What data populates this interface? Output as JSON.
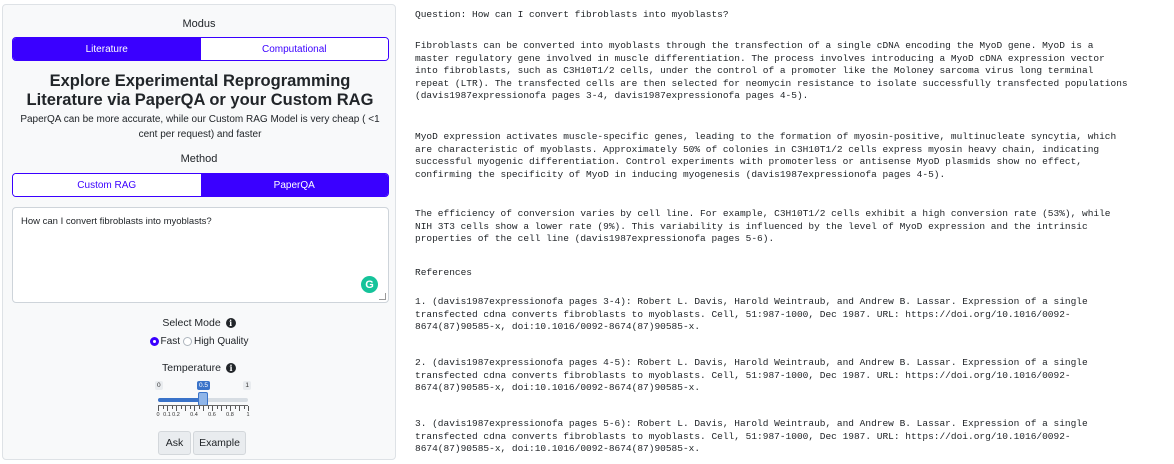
{
  "modus": {
    "label": "Modus",
    "options": [
      "Literature",
      "Computational"
    ],
    "selected": "Literature"
  },
  "hero": {
    "title": "Explore Experimental Reprogramming Literature via PaperQA or your Custom RAG",
    "description": "PaperQA can be more accurate, while our Custom RAG Model is very cheap ( <1 cent per request) and faster"
  },
  "method": {
    "label": "Method",
    "options": [
      "Custom RAG",
      "PaperQA"
    ],
    "selected": "PaperQA"
  },
  "question_input": {
    "value": "How can I convert fibroblasts into myoblasts?"
  },
  "icons": {
    "grammarly": "grammarly-icon",
    "info": "info-icon",
    "grammarly_glyph": "G",
    "info_glyph": "i"
  },
  "select_mode": {
    "label": "Select Mode",
    "options": [
      "Fast",
      "High Quality"
    ],
    "selected": "Fast"
  },
  "temperature": {
    "label": "Temperature",
    "min": "0",
    "max": "1",
    "value": 0.5,
    "value_label": "0.5",
    "tick_labels": [
      "0",
      "0.1",
      "0.2",
      "0.4",
      "0.6",
      "0.8",
      "1"
    ]
  },
  "buttons": {
    "ask": "Ask",
    "example": "Example"
  },
  "answer": {
    "question": "Question: How can I convert fibroblasts into myoblasts?",
    "paragraphs": [
      "Fibroblasts can be converted into myoblasts through the transfection of a single cDNA encoding the MyoD gene. MyoD is a\nmaster regulatory gene involved in muscle differentiation. The process involves introducing a MyoD cDNA expression vector\ninto fibroblasts, such as C3H10T1/2 cells, under the control of a promoter like the Moloney sarcoma virus long terminal\nrepeat (LTR). The transfected cells are then selected for neomycin resistance to isolate successfully transfected populations\n(davis1987expressionofa pages 3-4, davis1987expressionofa pages 4-5).",
      "MyoD expression activates muscle-specific genes, leading to the formation of myosin-positive, multinucleate syncytia, which\nare characteristic of myoblasts. Approximately 50% of colonies in C3H10T1/2 cells express myosin heavy chain, indicating\nsuccessful myogenic differentiation. Control experiments with promoterless or antisense MyoD plasmids show no effect,\nconfirming the specificity of MyoD in inducing myogenesis (davis1987expressionofa pages 4-5).",
      "The efficiency of conversion varies by cell line. For example, C3H10T1/2 cells exhibit a high conversion rate (53%), while\nNIH 3T3 cells show a lower rate (9%). This variability is influenced by the level of MyoD expression and the intrinsic\nproperties of the cell line (davis1987expressionofa pages 5-6).",
      "References",
      "1. (davis1987expressionofa pages 3-4): Robert L. Davis, Harold Weintraub, and Andrew B. Lassar. Expression of a single\ntransfected cdna converts fibroblasts to myoblasts. Cell, 51:987-1000, Dec 1987. URL: https://doi.org/10.1016/0092-\n8674(87)90585-x, doi:10.1016/0092-8674(87)90585-x.",
      "2. (davis1987expressionofa pages 4-5): Robert L. Davis, Harold Weintraub, and Andrew B. Lassar. Expression of a single\ntransfected cdna converts fibroblasts to myoblasts. Cell, 51:987-1000, Dec 1987. URL: https://doi.org/10.1016/0092-\n8674(87)90585-x, doi:10.1016/0092-8674(87)90585-x.",
      "3. (davis1987expressionofa pages 5-6): Robert L. Davis, Harold Weintraub, and Andrew B. Lassar. Expression of a single\ntransfected cdna converts fibroblasts to myoblasts. Cell, 51:987-1000, Dec 1987. URL: https://doi.org/10.1016/0092-\n8674(87)90585-x, doi:10.1016/0092-8674(87)90585-x."
    ]
  },
  "colors": {
    "accent": "#3a00ff",
    "slider": "#3a73c9",
    "grammarly": "#15c39a"
  }
}
